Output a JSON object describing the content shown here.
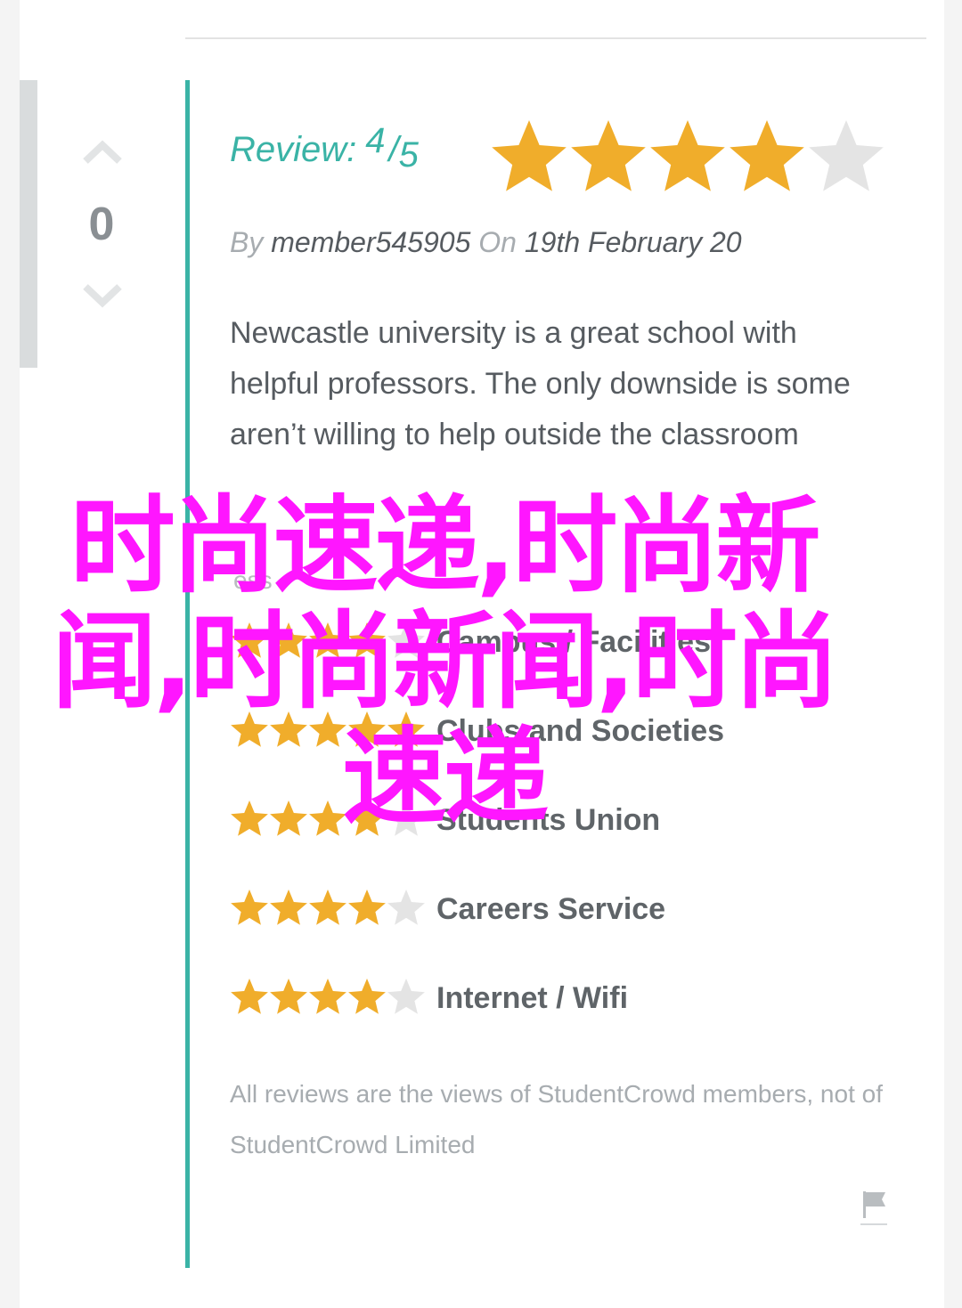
{
  "vote": {
    "count": "0"
  },
  "review": {
    "label": "Review:",
    "score": "4",
    "slash": "/",
    "out_of": "5",
    "rating": 4,
    "max": 5
  },
  "byline": {
    "by": "By",
    "author": "member545905",
    "on": "On",
    "date": "19th February 20"
  },
  "body": "Newcastle university is a great school with helpful professors. The only downside is some aren’t willing to help outside the classroom",
  "less_link": "ess",
  "categories": [
    {
      "label": "Campus / Facilities",
      "rating": 4
    },
    {
      "label": "Clubs and Societies",
      "rating": 5
    },
    {
      "label": "Students Union",
      "rating": 4
    },
    {
      "label": "Careers Service",
      "rating": 4
    },
    {
      "label": "Internet / Wifi",
      "rating": 4
    }
  ],
  "disclaimer": "All reviews are the views of StudentCrowd members, not of StudentCrowd Limited",
  "overlay_text": "时尚速递,时尚新闻,时尚新闻,时尚速递",
  "colors": {
    "accent": "#3ab3a6",
    "star_filled": "#f0ad2b",
    "star_empty": "#e4e4e4",
    "overlay": "#ff16ff"
  },
  "icons": {
    "upvote": "chevron-up-icon",
    "downvote": "chevron-down-icon",
    "report": "flag-icon"
  }
}
